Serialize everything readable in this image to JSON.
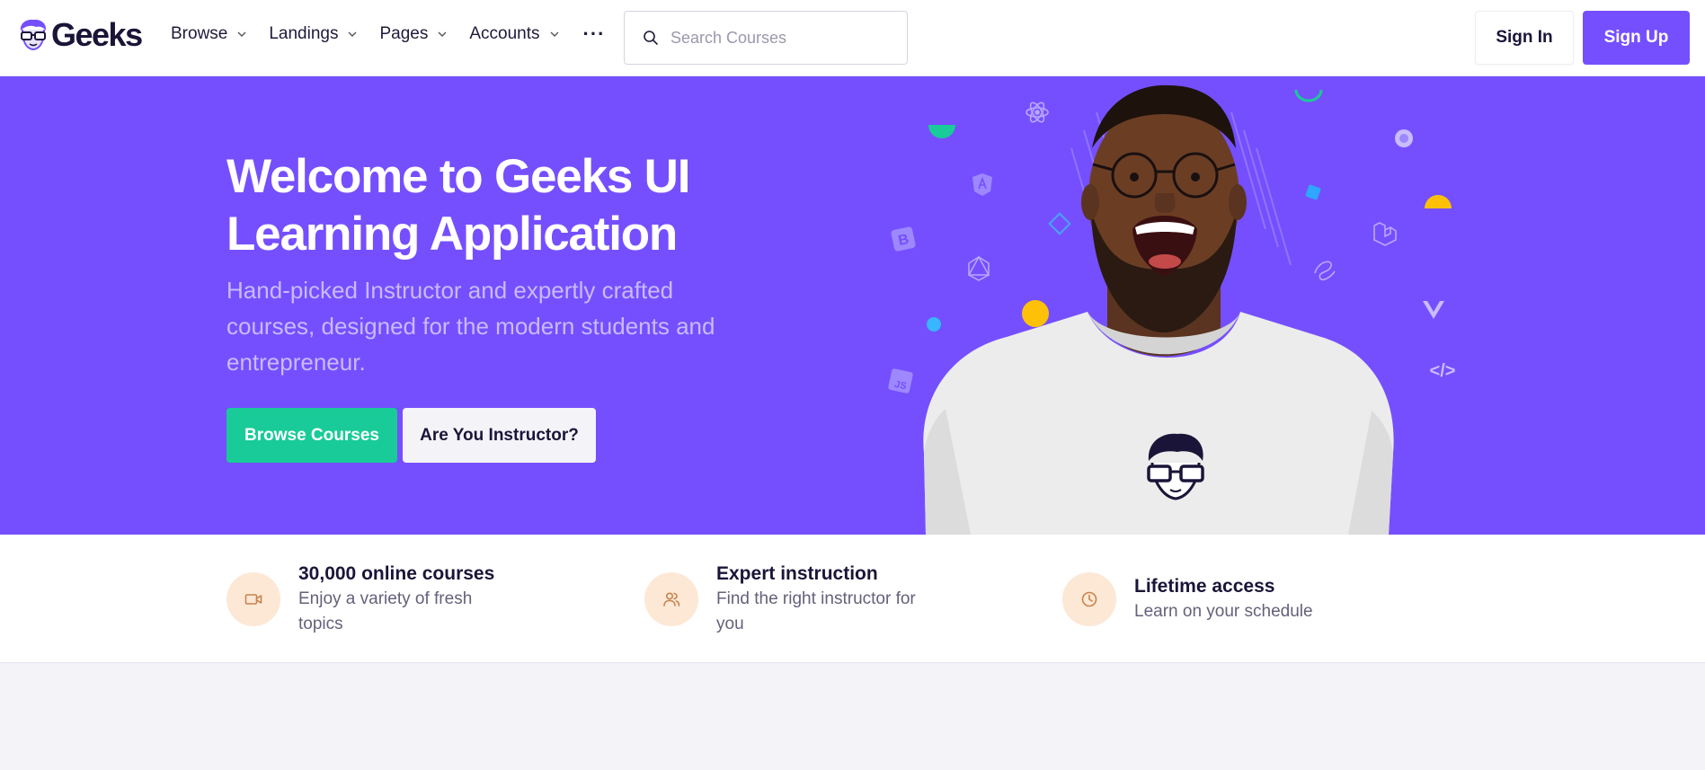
{
  "brand": {
    "name": "Geeks"
  },
  "nav": {
    "items": [
      {
        "label": "Browse"
      },
      {
        "label": "Landings"
      },
      {
        "label": "Pages"
      },
      {
        "label": "Accounts"
      }
    ],
    "more_label": "···"
  },
  "search": {
    "placeholder": "Search Courses",
    "value": ""
  },
  "auth": {
    "signin_label": "Sign In",
    "signup_label": "Sign Up"
  },
  "hero": {
    "title": "Welcome to Geeks UI Learning Application",
    "subtitle": "Hand-picked Instructor and expertly crafted courses, designed for the modern students and entrepreneur.",
    "primary_cta": "Browse Courses",
    "secondary_cta": "Are You Instructor?",
    "art_tags": {
      "bootstrap": "B",
      "angular": "A",
      "js": "JS",
      "code": "</>"
    }
  },
  "features": [
    {
      "icon": "video-icon",
      "title": "30,000 online courses",
      "desc": "Enjoy a variety of fresh topics"
    },
    {
      "icon": "users-icon",
      "title": "Expert instruction",
      "desc": "Find the right instructor for you"
    },
    {
      "icon": "clock-icon",
      "title": "Lifetime access",
      "desc": "Learn on your schedule"
    }
  ],
  "colors": {
    "primary": "#754ffe",
    "success": "#19cb98",
    "feature_icon_bg": "#fde8d6",
    "feature_icon_stroke": "#c8824a",
    "page_bg": "#f4f3f8"
  }
}
